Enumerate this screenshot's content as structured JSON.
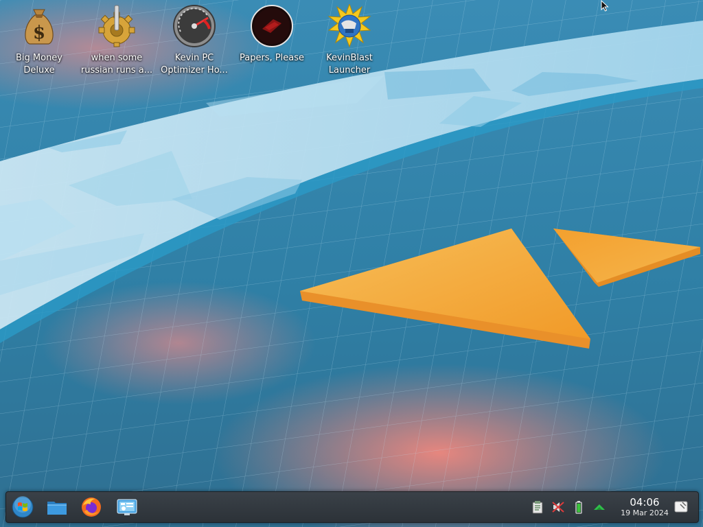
{
  "desktop": {
    "icons": [
      {
        "label_line1": "Big Money",
        "label_line2": "Deluxe",
        "icon": "money-bag-icon"
      },
      {
        "label_line1": "when some",
        "label_line2": "russian runs a...",
        "icon": "gear-joystick-icon"
      },
      {
        "label_line1": "Kevin PC",
        "label_line2": "Optimizer Ho...",
        "icon": "speedometer-icon"
      },
      {
        "label_line1": "Papers, Please",
        "label_line2": "",
        "icon": "papers-please-icon"
      },
      {
        "label_line1": "KevinBlast",
        "label_line2": "Launcher",
        "icon": "kevinblast-globe-icon"
      }
    ]
  },
  "taskbar": {
    "launchers": [
      {
        "name": "start-menu",
        "icon": "windows-logo-icon"
      },
      {
        "name": "file-manager",
        "icon": "folder-icon"
      },
      {
        "name": "firefox",
        "icon": "firefox-icon"
      },
      {
        "name": "system-settings",
        "icon": "settings-monitor-icon"
      }
    ],
    "tray": [
      {
        "name": "clipboard",
        "icon": "clipboard-icon"
      },
      {
        "name": "audio-muted",
        "icon": "speaker-muted-icon"
      },
      {
        "name": "battery",
        "icon": "battery-icon"
      },
      {
        "name": "network-updates",
        "icon": "arrow-up-icon"
      }
    ],
    "clock": {
      "time": "04:06",
      "date": "19 Mar 2024"
    },
    "show_desktop_icon": "show-desktop-icon"
  },
  "colors": {
    "wallpaper_blue": "#2e7fa6",
    "wallpaper_light": "#bfe3f2",
    "orange": "#f5a632",
    "taskbar": "#33393f"
  }
}
